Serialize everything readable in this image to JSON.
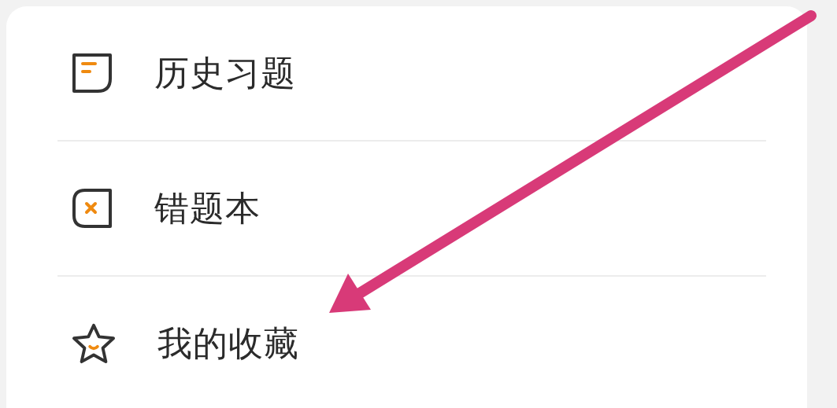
{
  "menu": {
    "items": [
      {
        "label": "历史习题",
        "kind": "history"
      },
      {
        "label": "错题本",
        "kind": "mistakes"
      },
      {
        "label": "我的收藏",
        "kind": "favorites"
      }
    ]
  },
  "annotation": {
    "kind": "arrow"
  }
}
